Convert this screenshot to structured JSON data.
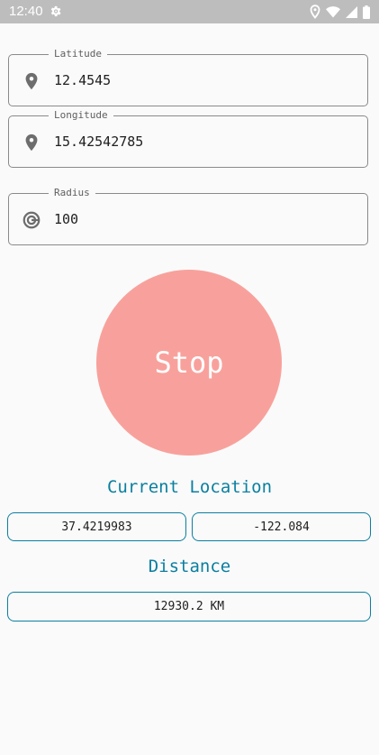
{
  "status_bar": {
    "time": "12:40",
    "icons": [
      "gear-icon",
      "location-icon",
      "wifi-icon",
      "signal-icon",
      "battery-icon"
    ]
  },
  "form": {
    "latitude": {
      "label": "Latitude",
      "value": "12.4545",
      "icon": "location-pin-icon"
    },
    "longitude": {
      "label": "Longitude",
      "value": "15.42542785",
      "icon": "location-pin-icon"
    },
    "radius": {
      "label": "Radius",
      "value": "100",
      "icon": "radius-target-icon"
    }
  },
  "stop_button": {
    "label": "Stop",
    "color": "#f8a19c"
  },
  "current_location": {
    "title": "Current Location",
    "latitude": "37.4219983",
    "longitude": "-122.084"
  },
  "distance": {
    "title": "Distance",
    "value": "12930.2 KM"
  },
  "colors": {
    "accent": "#0b7fa0",
    "status_bar": "#bdbdbd",
    "background": "#fafafa"
  }
}
